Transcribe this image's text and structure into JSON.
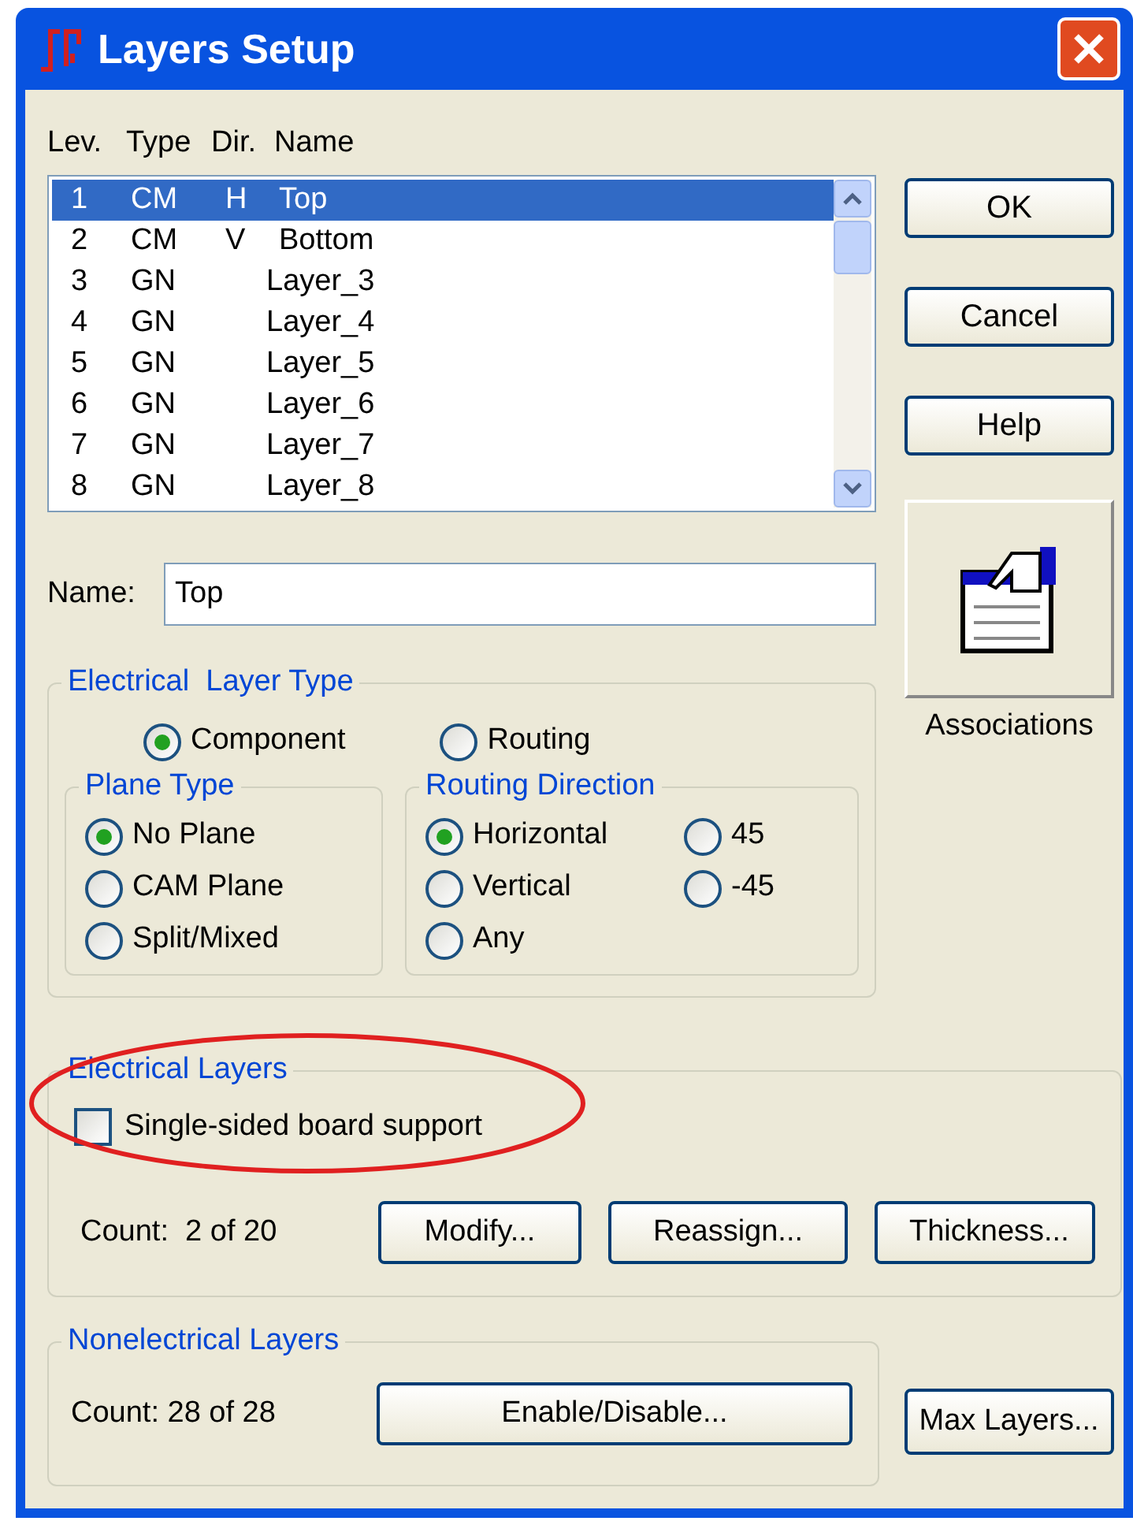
{
  "window": {
    "title": "Layers Setup"
  },
  "list_header": {
    "lev": "Lev.",
    "type": "Type",
    "dir": "Dir.",
    "name": "Name"
  },
  "layers": [
    {
      "lev": "1",
      "type": "CM",
      "dir": "H",
      "name": "Top",
      "selected": true
    },
    {
      "lev": "2",
      "type": "CM",
      "dir": "V",
      "name": "Bottom",
      "selected": false
    },
    {
      "lev": "3",
      "type": "GN",
      "name": "Layer_3",
      "selected": false
    },
    {
      "lev": "4",
      "type": "GN",
      "name": "Layer_4",
      "selected": false
    },
    {
      "lev": "5",
      "type": "GN",
      "name": "Layer_5",
      "selected": false
    },
    {
      "lev": "6",
      "type": "GN",
      "name": "Layer_6",
      "selected": false
    },
    {
      "lev": "7",
      "type": "GN",
      "name": "Layer_7",
      "selected": false
    },
    {
      "lev": "8",
      "type": "GN",
      "name": "Layer_8",
      "selected": false
    }
  ],
  "buttons": [
    "OK",
    "Cancel",
    "Help"
  ],
  "associations": {
    "label": "Associations"
  },
  "name_field": {
    "label": "Name:",
    "value": "Top"
  },
  "electrical_layer_type": {
    "title": "Electrical  Layer Type",
    "options": [
      {
        "label": "Component",
        "selected": true
      },
      {
        "label": "Routing",
        "selected": false
      }
    ],
    "plane_type": {
      "title": "Plane Type",
      "options": [
        {
          "label": "No Plane",
          "selected": true
        },
        {
          "label": "CAM Plane",
          "selected": false
        },
        {
          "label": "Split/Mixed",
          "selected": false
        }
      ]
    },
    "routing_direction": {
      "title": "Routing Direction",
      "options": [
        {
          "label": "Horizontal",
          "selected": true
        },
        {
          "label": "45",
          "selected": false
        },
        {
          "label": "Vertical",
          "selected": false
        },
        {
          "label": "-45",
          "selected": false
        },
        {
          "label": "Any",
          "selected": false
        }
      ]
    }
  },
  "electrical_layers": {
    "title": "Electrical Layers",
    "checkbox": {
      "label": "Single-sided board support",
      "checked": false
    },
    "highlighted": true,
    "count": "Count:  2 of 20",
    "buttons": [
      "Modify...",
      "Reassign...",
      "Thickness..."
    ]
  },
  "nonelectrical_layers": {
    "title": "Nonelectrical Layers",
    "count": "Count: 28 of 28",
    "button": "Enable/Disable..."
  },
  "max_layers_button": "Max Layers..."
}
